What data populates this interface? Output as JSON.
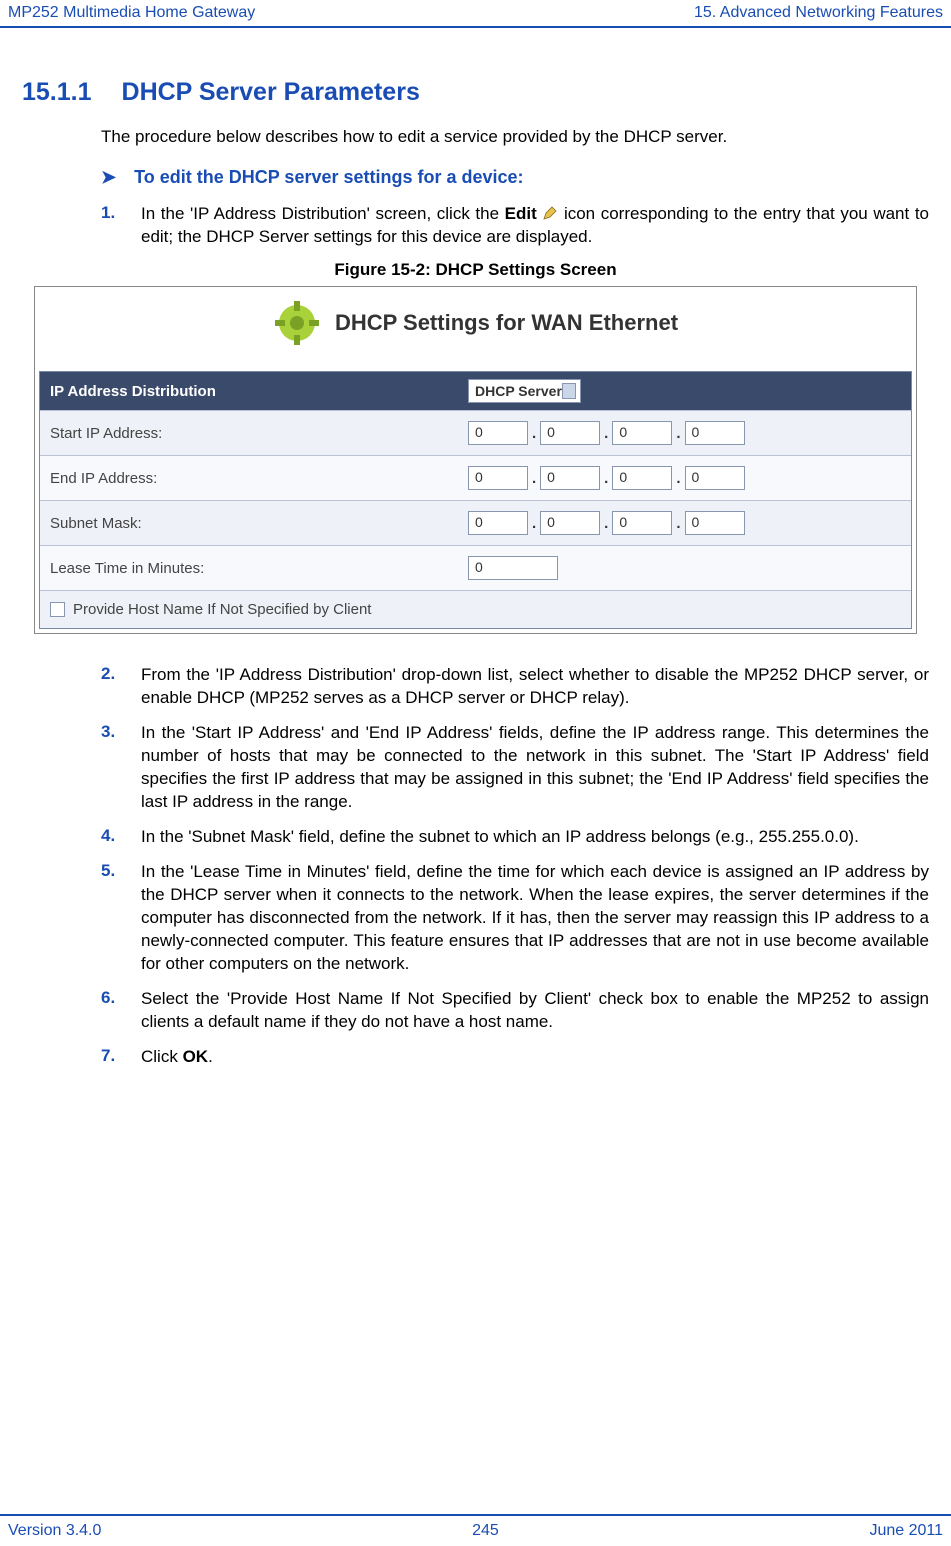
{
  "header": {
    "left": "MP252 Multimedia Home Gateway",
    "right": "15. Advanced Networking Features"
  },
  "section": {
    "number": "15.1.1",
    "title": "DHCP Server Parameters",
    "intro": "The procedure below describes how to edit a service provided by the DHCP server.",
    "task": "To edit the DHCP server settings for a device:"
  },
  "steps": {
    "s1_num": "1.",
    "s1_a": "In the 'IP Address Distribution' screen, click the ",
    "s1_b": "Edit",
    "s1_c": " icon corresponding to the entry that you want to edit; the DHCP Server settings for this device are displayed.",
    "s2_num": "2.",
    "s2": "From the 'IP Address Distribution' drop-down list, select whether to disable the MP252 DHCP server, or enable DHCP (MP252 serves as a DHCP server or DHCP relay).",
    "s3_num": "3.",
    "s3": "In the 'Start IP Address' and 'End IP Address' fields, define the IP address range. This determines the number of hosts that may be connected to the network in this subnet. The 'Start IP Address' field specifies the first IP address that may be assigned in this subnet; the 'End IP Address' field specifies the last IP address in the range.",
    "s4_num": "4.",
    "s4": "In the 'Subnet Mask' field, define the subnet to which an IP address belongs (e.g., 255.255.0.0).",
    "s5_num": "5.",
    "s5": "In the 'Lease Time in Minutes' field, define the time for which each device is assigned an IP address by the DHCP server when it connects to the network. When the lease expires, the server determines if the computer has disconnected from the network. If it has, then the server may reassign this IP address to a newly-connected computer. This feature ensures that IP addresses that are not in use become available for other computers on the network.",
    "s6_num": "6.",
    "s6": "Select the 'Provide Host Name If Not Specified by Client' check box to enable the MP252 to assign clients a default name if they do not have a host name.",
    "s7_num": "7.",
    "s7_a": "Click ",
    "s7_b": "OK",
    "s7_c": "."
  },
  "figure": {
    "caption": "Figure 15-2: DHCP Settings Screen",
    "title": "DHCP Settings for WAN Ethernet",
    "header_label": "IP Address Distribution",
    "dropdown_value": "DHCP Server",
    "rows": {
      "start_ip": "Start IP Address:",
      "end_ip": "End IP Address:",
      "subnet": "Subnet Mask:",
      "lease": "Lease Time in Minutes:"
    },
    "ip_values": {
      "a": "0",
      "b": "0",
      "c": "0",
      "d": "0"
    },
    "lease_value": "0",
    "checkbox_label": "Provide Host Name If Not Specified by Client"
  },
  "footer": {
    "left": "Version 3.4.0",
    "center": "245",
    "right": "June 2011"
  }
}
